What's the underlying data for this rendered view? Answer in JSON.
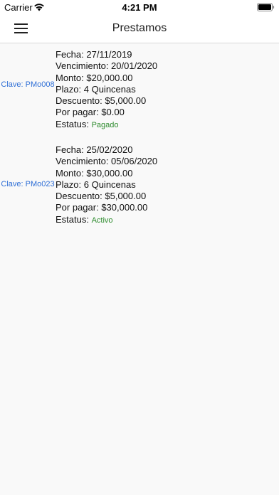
{
  "status_bar": {
    "carrier": "Carrier",
    "time": "4:21 PM",
    "wifi_icon": "wifi-icon",
    "battery_icon": "battery-full-icon"
  },
  "nav": {
    "title": "Prestamos",
    "menu_icon": "hamburger-menu-icon"
  },
  "loans": [
    {
      "clave": "Clave: PMo008",
      "fecha": "Fecha: 27/11/2019",
      "vencimiento": "Vencimiento: 20/01/2020",
      "monto": "Monto: $20,000.00",
      "plazo": "Plazo: 4 Quincenas",
      "descuento": "Descuento: $5,000.00",
      "por_pagar": "Por pagar: $0.00",
      "estatus_label": "Estatus:",
      "estatus_value": "Pagado"
    },
    {
      "clave": "Clave: PMo023",
      "fecha": "Fecha: 25/02/2020",
      "vencimiento": "Vencimiento: 05/06/2020",
      "monto": "Monto: $30,000.00",
      "plazo": "Plazo: 6 Quincenas",
      "descuento": "Descuento: $5,000.00",
      "por_pagar": "Por pagar: $30,000.00",
      "estatus_label": "Estatus:",
      "estatus_value": "Activo"
    }
  ],
  "colors": {
    "key_link": "#2f6fd6",
    "status_green": "#2e8b2e"
  }
}
